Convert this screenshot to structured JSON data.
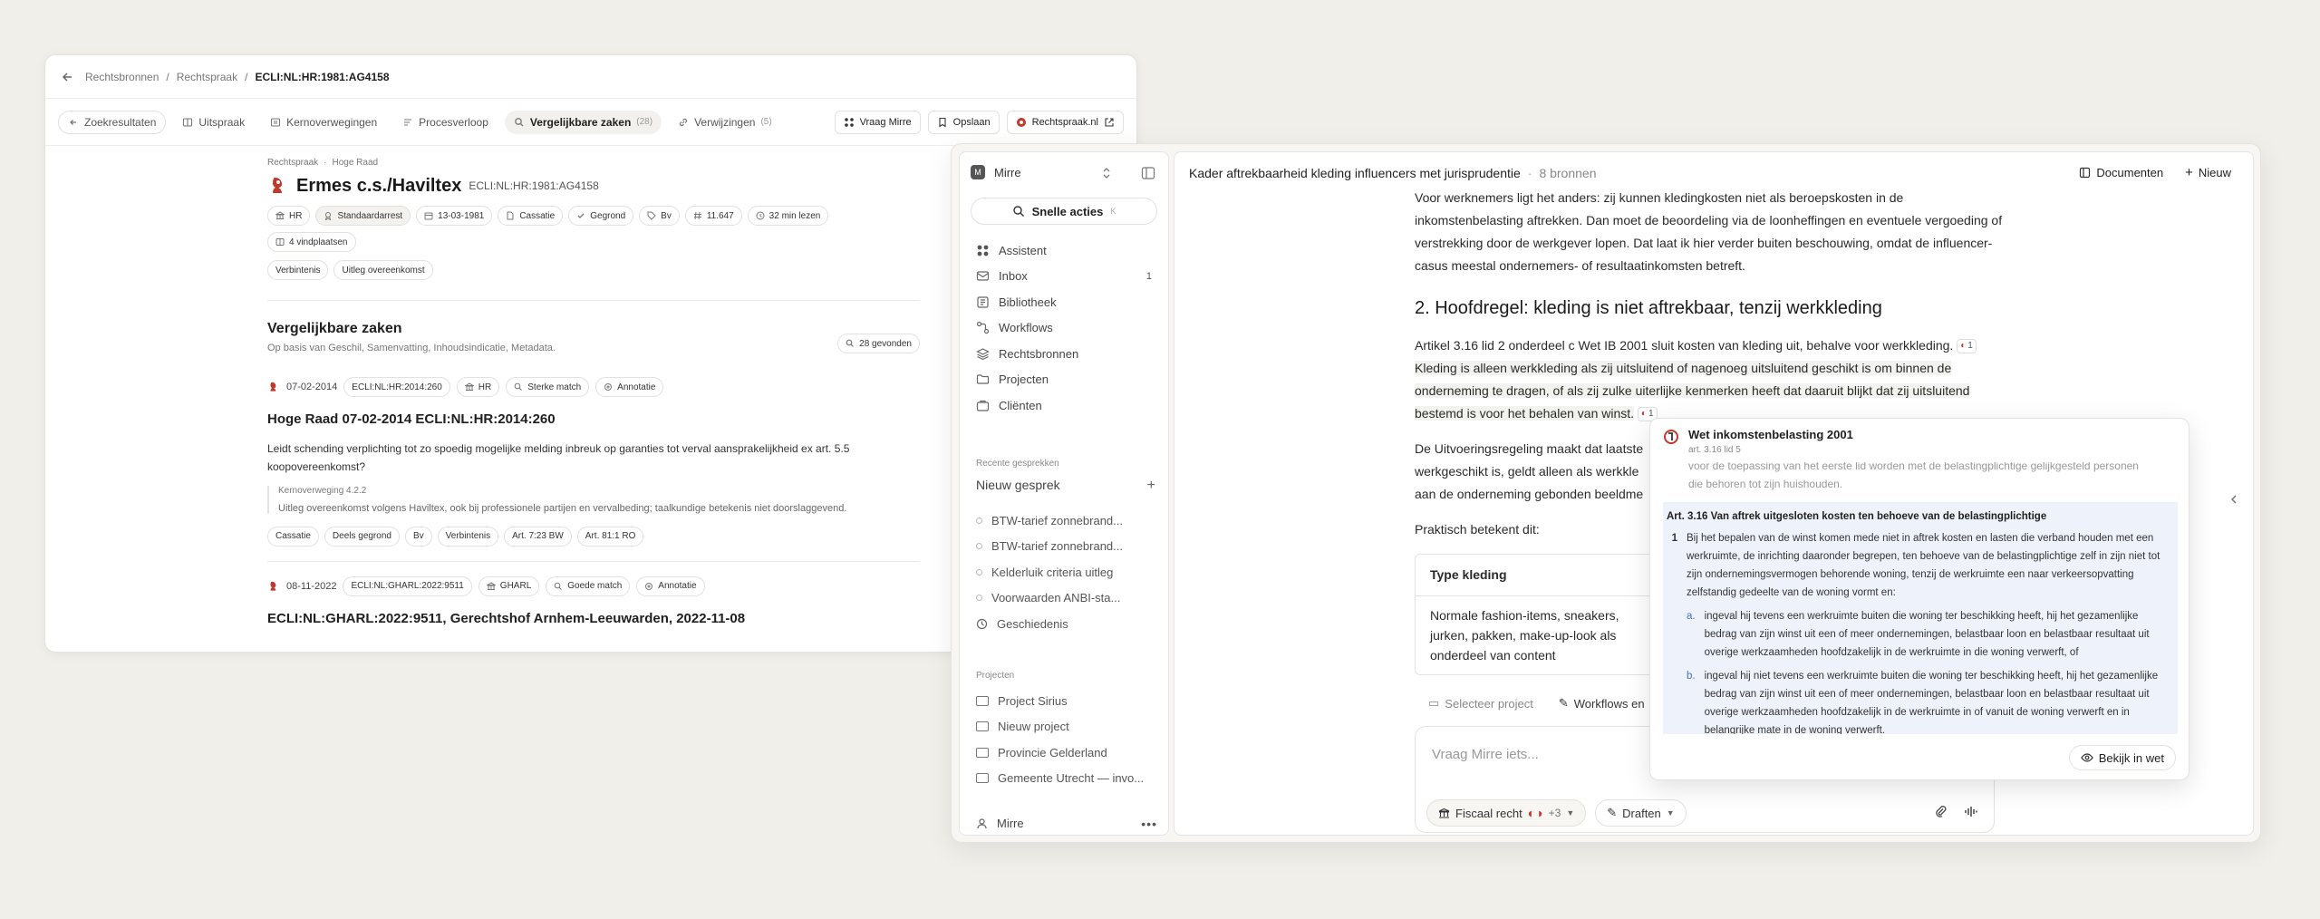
{
  "case_window": {
    "breadcrumb": [
      "Rechtsbronnen",
      "Rechtspraak",
      "ECLI:NL:HR:1981:AG4158"
    ],
    "tabs": {
      "back": "Zoekresultaten",
      "items": [
        {
          "label": "Uitspraak",
          "count": ""
        },
        {
          "label": "Kernoverwegingen",
          "count": ""
        },
        {
          "label": "Procesverloop",
          "count": ""
        },
        {
          "label": "Vergelijkbare zaken",
          "count": "(28)"
        },
        {
          "label": "Verwijzingen",
          "count": "(5)"
        }
      ],
      "actions": [
        "Vraag Mirre",
        "Opslaan",
        "Rechtspraak.nl"
      ]
    },
    "case": {
      "crumb": [
        "Rechtspraak",
        "Hoge Raad"
      ],
      "title": "Ermes c.s./Haviltex",
      "ecli": "ECLI:NL:HR:1981:AG4158",
      "chips": [
        "HR",
        "Standaardarrest",
        "13-03-1981",
        "Cassatie",
        "Gegrond",
        "Bv",
        "11.647",
        "32 min lezen"
      ],
      "chips2": [
        "4 vindplaatsen"
      ],
      "tags": [
        "Verbintenis",
        "Uitleg overeenkomst"
      ]
    },
    "similar": {
      "title": "Vergelijkbare zaken",
      "subtitle": "Op basis van Geschil, Samenvatting, Inhoudsindicatie, Metadata.",
      "found": "28 gevonden",
      "results": [
        {
          "date": "07-02-2014",
          "ecli": "ECLI:NL:HR:2014:260",
          "court": "HR",
          "match": "Sterke match",
          "annot": "Annotatie",
          "title": "Hoge Raad 07-02-2014 ECLI:NL:HR:2014:260",
          "body": "Leidt schending verplichting tot zo spoedig mogelijke melding inbreuk op garanties tot verval aansprakelijkheid ex art. 5.5 koopovereenkomst?",
          "quote_label": "Kernoverweging 4.2.2",
          "quote": "Uitleg overeenkomst volgens Haviltex, ook bij professionele partijen en vervalbeding; taalkundige betekenis niet doorslaggevend.",
          "tags": [
            "Cassatie",
            "Deels gegrond",
            "Bv",
            "Verbintenis",
            "Art. 7:23 BW",
            "Art. 81:1 RO"
          ]
        },
        {
          "date": "08-11-2022",
          "ecli": "ECLI:NL:GHARL:2022:9511",
          "court": "GHARL",
          "match": "Goede match",
          "annot": "Annotatie",
          "title": "ECLI:NL:GHARL:2022:9511, Gerechtshof Arnhem-Leeuwarden, 2022-11-08"
        }
      ]
    }
  },
  "mirre": {
    "workspace": "Mirre",
    "quick_actions": "Snelle acties",
    "quick_key": "K",
    "nav": [
      {
        "label": "Assistent",
        "icon": "assistant-icon",
        "badge": ""
      },
      {
        "label": "Inbox",
        "icon": "inbox-icon",
        "badge": "1"
      },
      {
        "label": "Bibliotheek",
        "icon": "library-icon",
        "badge": ""
      },
      {
        "label": "Workflows",
        "icon": "workflow-icon",
        "badge": ""
      },
      {
        "label": "Rechtsbronnen",
        "icon": "layers-icon",
        "badge": ""
      },
      {
        "label": "Projecten",
        "icon": "folder-icon",
        "badge": ""
      },
      {
        "label": "Cliënten",
        "icon": "clients-icon",
        "badge": ""
      }
    ],
    "recent_label": "Recente gesprekken",
    "new_conversation": "Nieuw gesprek",
    "recent": [
      "BTW-tarief zonnebrand...",
      "BTW-tarief zonnebrand...",
      "Kelderluik criteria uitleg",
      "Voorwaarden ANBI-sta..."
    ],
    "history": "Geschiedenis",
    "projects_label": "Projecten",
    "projects": [
      "Project Sirius",
      "Nieuw project",
      "Provincie Gelderland",
      "Gemeente Utrecht — invo..."
    ],
    "user": "Mirre",
    "header": {
      "title": "Kader aftrekbaarheid kleding influencers met jurisprudentie",
      "sources": "8 bronnen",
      "documents": "Documenten",
      "new": "Nieuw"
    },
    "doc": {
      "p1": "Voor werknemers ligt het anders: zij kunnen kledingkosten niet als beroepskosten in de inkomstenbelasting aftrekken. Dan moet de beoordeling via de loonheffingen en eventuele vergoeding of verstrekking door de werkgever lopen. Dat laat ik hier verder buiten beschouwing, omdat de influencer-casus meestal ondernemers- of resultaatinkomsten betreft.",
      "h2": "2. Hoofdregel: kleding is niet aftrekbaar, tenzij werkkleding",
      "p2a": "Artikel 3.16 lid 2 onderdeel c Wet IB 2001 sluit kosten van kleding uit, behalve voor werkkleding.",
      "p2b": "Kleding is alleen werkkleding als zij uitsluitend of nagenoeg uitsluitend geschikt is om binnen de onderneming te dragen, of als zij zulke uiterlijke kenmerken heeft dat daaruit blijkt dat zij uitsluitend bestemd is voor het behalen van winst.",
      "cite": "1",
      "p3": "De Uitvoeringsregeling maakt dat laatste",
      "p3b": "werkgeschikt is, geldt alleen als werkkle",
      "p3c": "aan de onderneming gebonden beeldme",
      "p4": "Praktisch betekent dit:",
      "table_head": "Type kleding",
      "table_cell": "Normale fashion-items, sneakers, jurken, pakken, make-up-look als onderdeel van content"
    },
    "composer": {
      "select_project": "Selecteer project",
      "workflows": "Workflows en",
      "placeholder": "Vraag Mirre iets...",
      "domain": "Fiscaal recht",
      "more": "+3",
      "mode": "Draften"
    },
    "popover": {
      "title": "Wet inkomstenbelasting 2001",
      "subtitle": "art. 3.16 lid 5",
      "faded": "die behoren tot zijn huishouden.",
      "faded_top": "voor de toepassing van het eerste lid worden met de belastingplichtige gelijkgesteld personen",
      "art_heading": "Art. 3.16 Van aftrek uitgesloten kosten ten behoeve van de belastingplichtige",
      "item_num": "1",
      "item_text": "Bij het bepalen van de winst komen mede niet in aftrek kosten en lasten die verband houden met een werkruimte, de inrichting daaronder begrepen, ten behoeve van de belastingplichtige zelf in zijn niet tot zijn ondernemingsvermogen behorende woning, tenzij de werkruimte een naar verkeersopvatting zelfstandig gedeelte van de woning vormt en:",
      "sub": [
        {
          "n": "a.",
          "t": "ingeval hij tevens een werkruimte buiten die woning ter beschikking heeft, hij het gezamenlijke bedrag van zijn winst uit een of meer ondernemingen, belastbaar loon en belastbaar resultaat uit overige werkzaamheden hoofdzakelijk in de werkruimte in die woning verwerft, of"
        },
        {
          "n": "b.",
          "t": "ingeval hij niet tevens een werkruimte buiten die woning ter beschikking heeft, hij het gezamenlijke bedrag van zijn winst uit een of meer ondernemingen, belastbaar loon en belastbaar resultaat uit overige werkzaamheden hoofdzakelijk in de werkruimte in of vanuit de woning verwerft en in belangrijke mate in de woning verwerft."
        }
      ],
      "action": "Bekijk in wet"
    }
  }
}
